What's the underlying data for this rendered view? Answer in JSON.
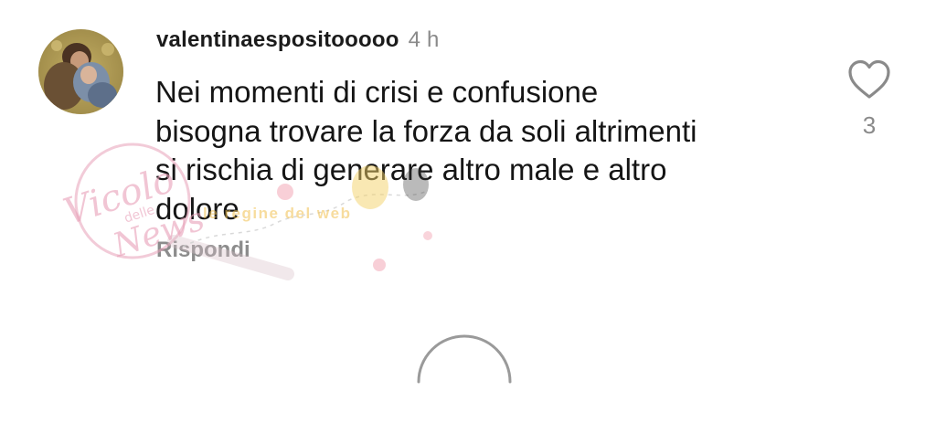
{
  "comment": {
    "username": "valentinaespositooooo",
    "time": "4 h",
    "text": "Nei momenti di crisi e confusione\nbisogna trovare la forza da soli altrimenti\nsi rischia di generare altro male e altro\ndolore",
    "reply_label": "Rispondi",
    "like_count": "3",
    "like_icon": "heart-outline-icon"
  },
  "watermark": {
    "brand_line1": "Vicolo",
    "brand_line2": "delle",
    "brand_line3": "News",
    "tagline": "le regine del web"
  },
  "loading": {
    "icon": "loading-spinner-icon"
  },
  "colors": {
    "text": "#151515",
    "muted": "#8a8a8a",
    "watermark_pink": "#e8a0b8",
    "watermark_yellow": "#f2c14f"
  }
}
